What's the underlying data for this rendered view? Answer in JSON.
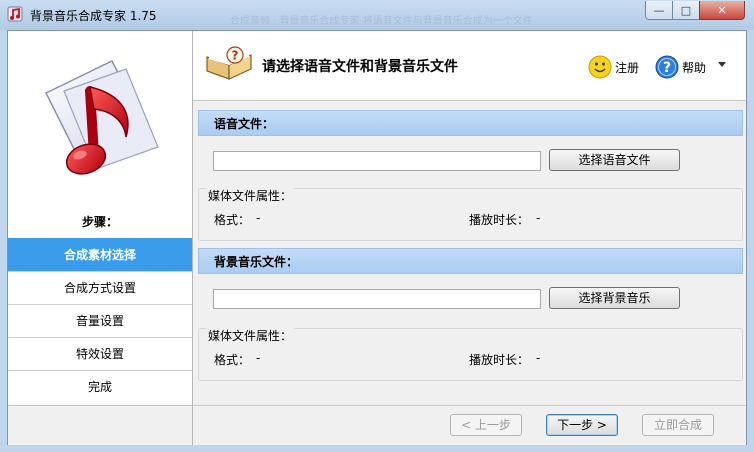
{
  "window": {
    "title": "背景音乐合成专家 1.75",
    "ghost_text": "合成音频 · 背景音乐合成专家 将语音文件与背景音乐合成为一个文件",
    "controls": {
      "minimize": "—",
      "maximize": "□",
      "close": "✕"
    }
  },
  "sidebar": {
    "steps_label": "步骤：",
    "steps": [
      {
        "label": "合成素材选择",
        "active": true
      },
      {
        "label": "合成方式设置",
        "active": false
      },
      {
        "label": "音量设置",
        "active": false
      },
      {
        "label": "特效设置",
        "active": false
      },
      {
        "label": "完成",
        "active": false
      }
    ]
  },
  "header": {
    "title": "请选择语音文件和背景音乐文件",
    "register_label": "注册",
    "help_label": "帮助"
  },
  "voice": {
    "section_title": "语音文件：",
    "path_value": "",
    "select_button": "选择语音文件",
    "props_title": "媒体文件属性：",
    "format_label": "格式：",
    "format_value": "-",
    "duration_label": "播放时长：",
    "duration_value": "-"
  },
  "music": {
    "section_title": "背景音乐文件：",
    "path_value": "",
    "select_button": "选择背景音乐",
    "props_title": "媒体文件属性：",
    "format_label": "格式：",
    "format_value": "-",
    "duration_label": "播放时长：",
    "duration_value": "-"
  },
  "footer": {
    "prev_button": "< 上一步",
    "next_button": "下一步 >",
    "merge_button": "立即合成"
  },
  "colors": {
    "active_step": "#3c9cec",
    "section_bar": "#b5d4f4",
    "titlebar": "#bfd5ec",
    "close_button": "#c9483a"
  },
  "icons": {
    "app": "music-note-icon",
    "logo": "music-note-logo",
    "header": "book-question-icon",
    "register": "smiley-icon",
    "help": "help-icon",
    "help_menu": "chevron-down-icon"
  }
}
